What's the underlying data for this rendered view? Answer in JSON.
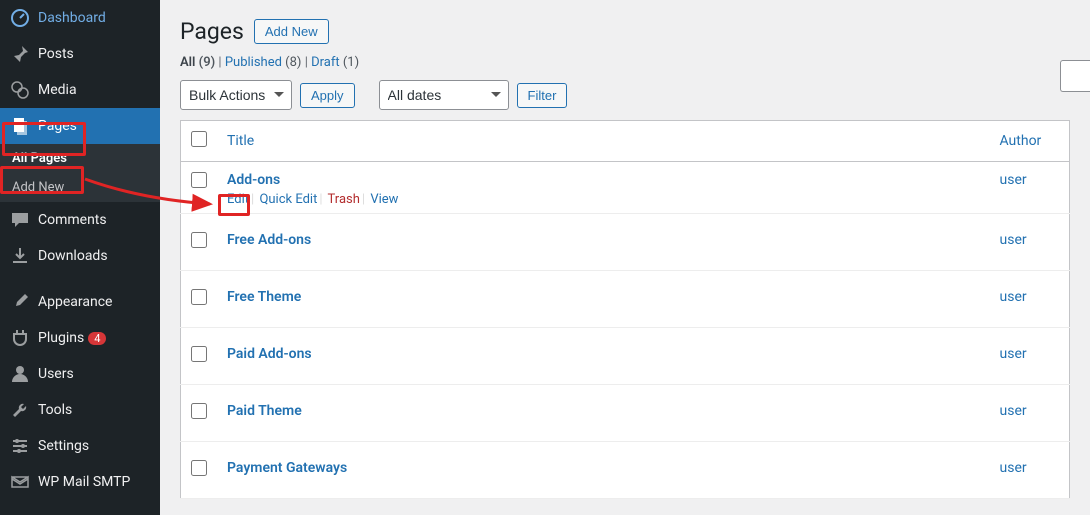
{
  "sidebar": {
    "items": [
      {
        "name": "dashboard",
        "label": "Dashboard"
      },
      {
        "name": "posts",
        "label": "Posts"
      },
      {
        "name": "media",
        "label": "Media"
      },
      {
        "name": "pages",
        "label": "Pages",
        "active": true
      },
      {
        "name": "comments",
        "label": "Comments"
      },
      {
        "name": "downloads",
        "label": "Downloads"
      },
      {
        "name": "appearance",
        "label": "Appearance"
      },
      {
        "name": "plugins",
        "label": "Plugins",
        "badge": "4"
      },
      {
        "name": "users",
        "label": "Users"
      },
      {
        "name": "tools",
        "label": "Tools"
      },
      {
        "name": "settings",
        "label": "Settings"
      },
      {
        "name": "wpmailsmtp",
        "label": "WP Mail SMTP"
      }
    ],
    "submenu": {
      "all_pages": "All Pages",
      "add_new": "Add New"
    }
  },
  "header": {
    "title": "Pages",
    "add_new": "Add New"
  },
  "filters": {
    "all_label": "All",
    "all_count": "(9)",
    "published_label": "Published",
    "published_count": "(8)",
    "draft_label": "Draft",
    "draft_count": "(1)"
  },
  "tablenav": {
    "bulk_actions": "Bulk Actions",
    "apply": "Apply",
    "all_dates": "All dates",
    "filter": "Filter"
  },
  "table": {
    "columns": {
      "title": "Title",
      "author": "Author"
    },
    "row_actions": {
      "edit": "Edit",
      "quick_edit": "Quick Edit",
      "trash": "Trash",
      "view": "View"
    },
    "rows": [
      {
        "title": "Add-ons",
        "author": "user",
        "show_actions": true
      },
      {
        "title": "Free Add-ons",
        "author": "user"
      },
      {
        "title": "Free Theme",
        "author": "user"
      },
      {
        "title": "Paid Add-ons",
        "author": "user"
      },
      {
        "title": "Paid Theme",
        "author": "user"
      },
      {
        "title": "Payment Gateways",
        "author": "user"
      }
    ]
  }
}
